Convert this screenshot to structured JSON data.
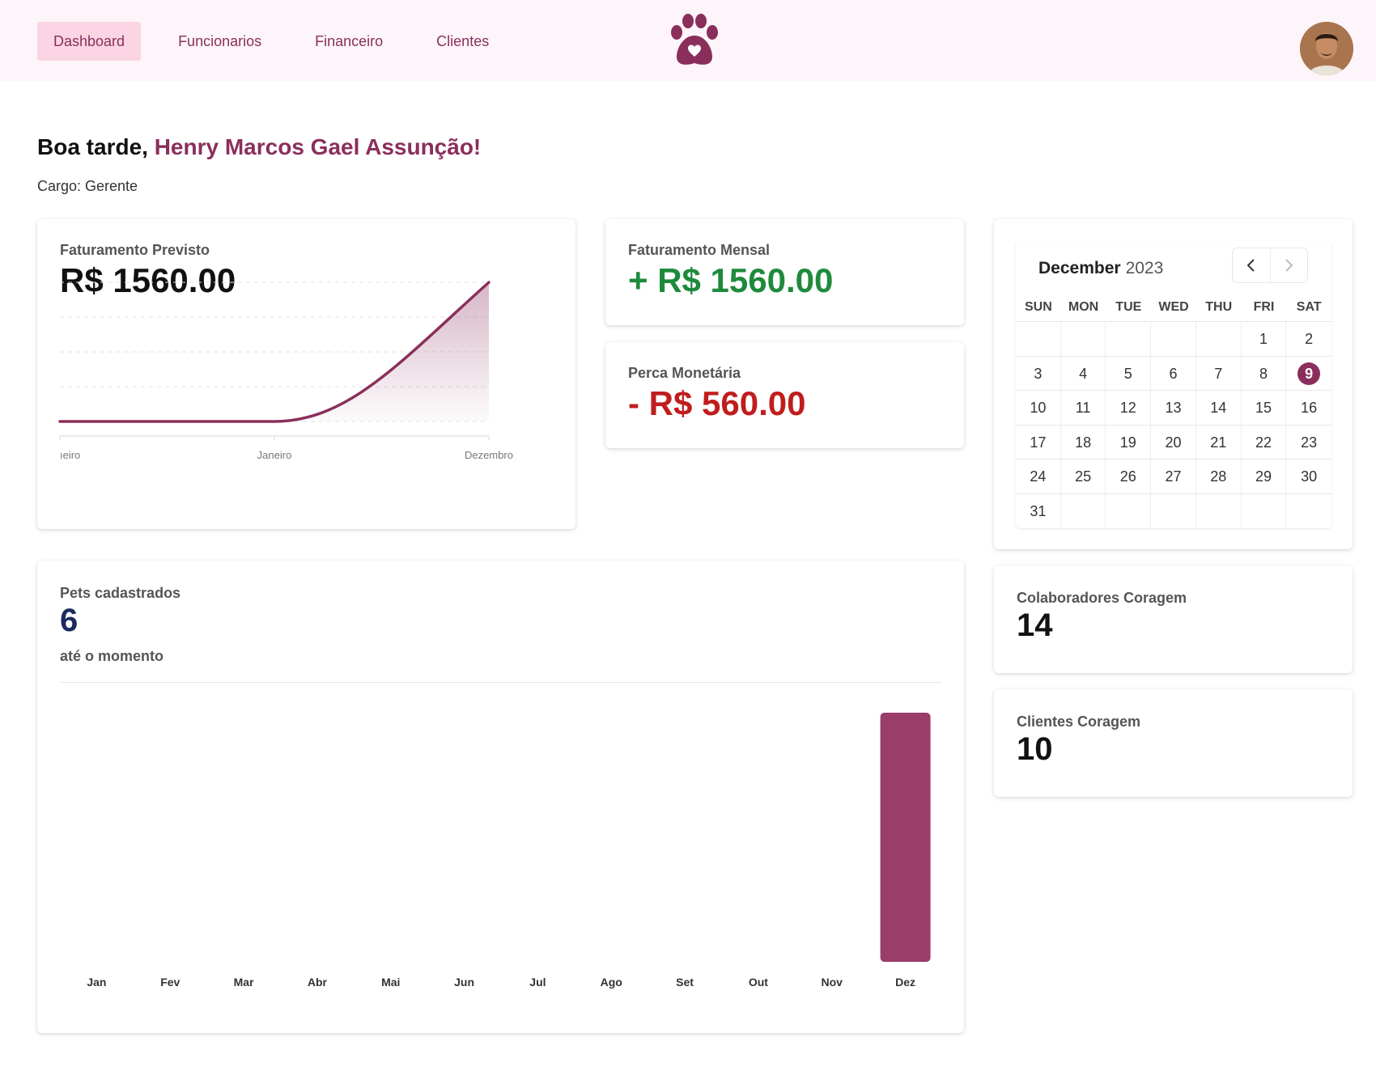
{
  "nav": {
    "items": [
      {
        "label": "Dashboard",
        "active": true
      },
      {
        "label": "Funcionarios",
        "active": false
      },
      {
        "label": "Financeiro",
        "active": false
      },
      {
        "label": "Clientes",
        "active": false
      }
    ],
    "logo_icon": "paw-heart-icon",
    "avatar_icon": "user-avatar"
  },
  "greeting": {
    "prefix": "Boa tarde, ",
    "name": "Henry Marcos Gael Assunção!",
    "role": "Cargo: Gerente"
  },
  "faturamento_previsto": {
    "label": "Faturamento Previsto",
    "value": "R$ 1560.00"
  },
  "faturamento_mensal": {
    "label": "Faturamento Mensal",
    "value": "+ R$ 1560.00"
  },
  "perca_monetaria": {
    "label": "Perca Monetária",
    "value": "- R$ 560.00"
  },
  "calendar": {
    "month": "December",
    "year": "2023",
    "weekdays": [
      "SUN",
      "MON",
      "TUE",
      "WED",
      "THU",
      "FRI",
      "SAT"
    ],
    "weeks": [
      [
        "",
        "",
        "",
        "",
        "",
        "1",
        "2"
      ],
      [
        "3",
        "4",
        "5",
        "6",
        "7",
        "8",
        "9"
      ],
      [
        "10",
        "11",
        "12",
        "13",
        "14",
        "15",
        "16"
      ],
      [
        "17",
        "18",
        "19",
        "20",
        "21",
        "22",
        "23"
      ],
      [
        "24",
        "25",
        "26",
        "27",
        "28",
        "29",
        "30"
      ],
      [
        "31",
        "",
        "",
        "",
        "",
        "",
        ""
      ]
    ],
    "selected_day": "9",
    "accent": "#8a2f5c"
  },
  "pets": {
    "label": "Pets cadastrados",
    "value": "6",
    "subtitle": "até o momento"
  },
  "colaboradores": {
    "label": "Colaboradores Coragem",
    "value": "14"
  },
  "clientes": {
    "label": "Clientes Coragem",
    "value": "10"
  },
  "colors": {
    "accent": "#8a2f5c",
    "nav_active_bg": "#fbd5e3",
    "positive": "#1e8a3c",
    "negative": "#c01d1d",
    "bar": "#9a3d68"
  },
  "chart_data": [
    {
      "type": "area",
      "x_tick_labels": [
        "ıeiro",
        "Janeiro",
        "Dezembro"
      ],
      "x": [
        0,
        1,
        2
      ],
      "values": [
        0,
        0,
        1560
      ],
      "grid": true,
      "legend": "none"
    },
    {
      "type": "bar",
      "categories": [
        "Jan",
        "Fev",
        "Mar",
        "Abr",
        "Mai",
        "Jun",
        "Jul",
        "Ago",
        "Set",
        "Out",
        "Nov",
        "Dez"
      ],
      "values": [
        0,
        0,
        0,
        0,
        0,
        0,
        0,
        0,
        0,
        0,
        0,
        6
      ],
      "grid": false,
      "legend": "none"
    }
  ]
}
